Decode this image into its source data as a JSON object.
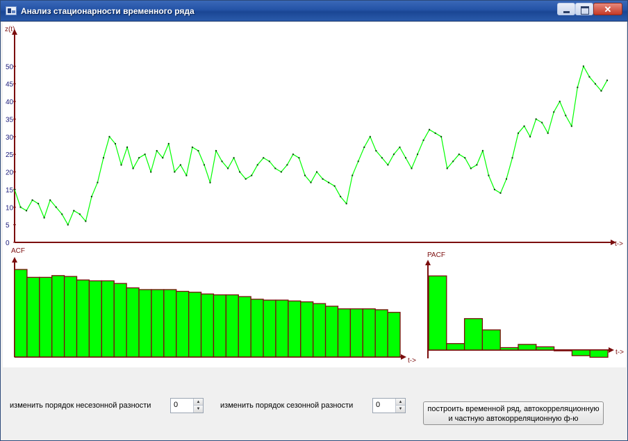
{
  "window": {
    "title": "Анализ стационарности временного ряда"
  },
  "colors": {
    "axis": "#7b0d0d",
    "series": "#00ff00",
    "bar_fill": "#00ff00",
    "bar_stroke": "#7b0d0d",
    "tick_text": "#1a1a7a",
    "titlebar": "#2453a6"
  },
  "controls": {
    "nonseasonal_label": "изменить порядок несезонной разности",
    "nonseasonal_value": "0",
    "seasonal_label": "изменить порядок сезонной разности",
    "seasonal_value": "0",
    "build_button_line1": "построить временной ряд, автокорреляционную",
    "build_button_line2": "и частную автокорреляционную ф-ю"
  },
  "chart_data": [
    {
      "type": "line",
      "ylabel": "z(t)",
      "xlabel": "t->",
      "ylim": [
        0,
        55
      ],
      "yticks": [
        0,
        5,
        10,
        15,
        20,
        25,
        30,
        35,
        40,
        45,
        50
      ],
      "x": [
        0,
        4,
        8,
        12,
        16,
        20,
        24,
        28,
        32,
        36,
        40,
        44,
        48,
        52,
        56,
        60,
        64,
        68,
        72,
        76,
        80,
        84,
        88,
        92,
        96,
        100,
        104,
        108,
        112,
        116,
        120,
        124,
        128,
        132,
        136,
        140,
        144,
        148,
        152,
        156,
        160,
        164,
        168,
        172,
        176,
        180,
        184,
        188,
        192,
        196,
        200,
        204,
        208,
        212,
        216,
        220,
        224,
        228,
        232,
        236,
        240,
        244,
        248,
        252,
        256,
        260,
        264,
        268,
        272,
        276,
        280,
        284,
        288,
        292,
        296,
        300,
        304,
        308,
        312,
        316,
        320,
        324,
        328,
        332,
        336,
        340,
        344,
        348,
        352,
        356,
        360,
        364,
        368,
        372,
        376,
        380,
        384,
        388,
        392,
        396,
        400
      ],
      "values": [
        15,
        10,
        9,
        12,
        11,
        7,
        12,
        10,
        8,
        5,
        9,
        8,
        6,
        13,
        17,
        24,
        30,
        28,
        22,
        27,
        21,
        24,
        25,
        20,
        26,
        24,
        28,
        20,
        22,
        19,
        27,
        26,
        22,
        17,
        26,
        23,
        21,
        24,
        20,
        18,
        19,
        22,
        24,
        23,
        21,
        20,
        22,
        25,
        24,
        19,
        17,
        20,
        18,
        17,
        16,
        13,
        11,
        19,
        23,
        27,
        30,
        26,
        24,
        22,
        25,
        27,
        24,
        21,
        25,
        29,
        32,
        31,
        30,
        21,
        23,
        25,
        24,
        21,
        22,
        26,
        19,
        15,
        14,
        18,
        24,
        31,
        33,
        30,
        35,
        34,
        31,
        37,
        40,
        36,
        33,
        44,
        50,
        47,
        45,
        43,
        46
      ]
    },
    {
      "type": "bar",
      "title": "ACF",
      "xlabel": "t->",
      "ylim": [
        0,
        1
      ],
      "values": [
        1.0,
        0.91,
        0.91,
        0.93,
        0.92,
        0.88,
        0.87,
        0.87,
        0.84,
        0.79,
        0.77,
        0.77,
        0.77,
        0.75,
        0.74,
        0.72,
        0.71,
        0.71,
        0.69,
        0.66,
        0.65,
        0.65,
        0.64,
        0.63,
        0.61,
        0.58,
        0.55,
        0.55,
        0.55,
        0.54,
        0.51
      ]
    },
    {
      "type": "bar",
      "title": "PACF",
      "xlabel": "t->",
      "ylim": [
        -0.2,
        1
      ],
      "values": [
        0.92,
        0.08,
        0.39,
        0.25,
        0.03,
        0.07,
        0.04,
        -0.01,
        -0.07,
        -0.09
      ]
    }
  ]
}
